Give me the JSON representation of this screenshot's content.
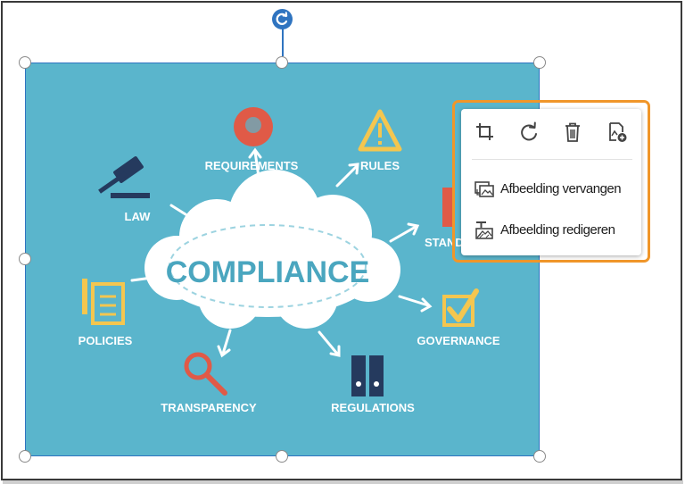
{
  "image": {
    "title": "COMPLIANCE",
    "labels": {
      "requirements": "REQUIREMENTS",
      "rules": "RULES",
      "law": "LAW",
      "standards": "STAND",
      "policies": "POLICIES",
      "governance": "GOVERNANCE",
      "transparency": "TRANSPARENCY",
      "regulations": "REGULATIONS"
    },
    "colors": {
      "background": "#5ab5cc",
      "red": "#e05a47",
      "yellow": "#f4c64f",
      "navy": "#253a5e"
    }
  },
  "selection": {
    "color": "#2f74c0"
  },
  "popup": {
    "tools": [
      "crop-icon",
      "rotate-icon",
      "delete-icon",
      "replace-image-icon"
    ],
    "replace_label": "Afbeelding vervangen",
    "edit_label": "Afbeelding redigeren",
    "highlight_color": "#f0962a"
  }
}
